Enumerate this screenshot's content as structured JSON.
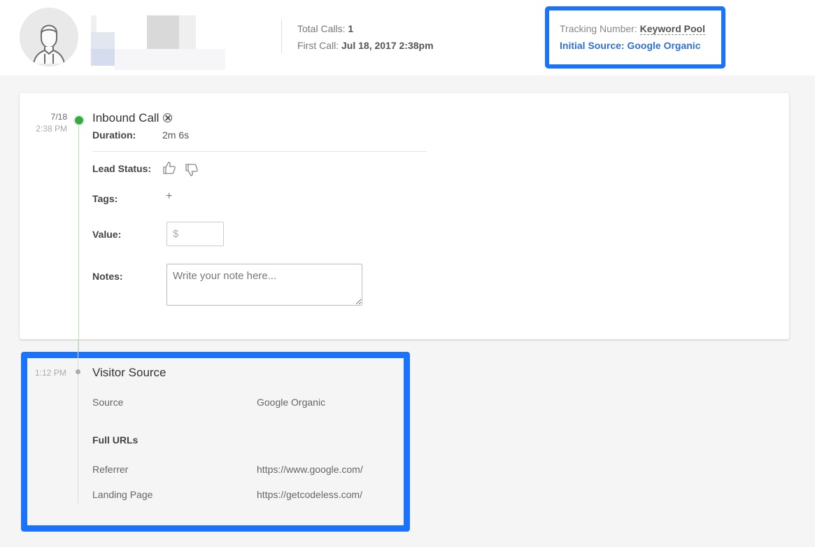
{
  "header": {
    "total_calls_label": "Total Calls:",
    "total_calls_value": "1",
    "first_call_label": "First Call:",
    "first_call_value": "Jul 18, 2017 2:38pm",
    "tracking_number_label": "Tracking Number:",
    "tracking_number_value": "Keyword Pool",
    "initial_source_label": "Initial Source:",
    "initial_source_value": "Google Organic"
  },
  "call": {
    "date": "7/18",
    "time": "2:38 PM",
    "title": "Inbound Call",
    "icon": "cancel-circle-icon",
    "duration_label": "Duration:",
    "duration_value": "2m 6s",
    "lead_status_label": "Lead Status:",
    "tags_label": "Tags:",
    "tags_add": "+",
    "value_label": "Value:",
    "value_placeholder": "$",
    "notes_label": "Notes:",
    "notes_placeholder": "Write your note here..."
  },
  "visitor_source": {
    "time": "1:12 PM",
    "title": "Visitor Source",
    "source_label": "Source",
    "source_value": "Google Organic",
    "full_urls_label": "Full URLs",
    "referrer_label": "Referrer",
    "referrer_value": "https://www.google.com/",
    "landing_label": "Landing Page",
    "landing_value": "https://getcodeless.com/"
  },
  "colors": {
    "highlight": "#1a73ff",
    "link": "#2f6fd6",
    "status_green": "#37a943"
  }
}
